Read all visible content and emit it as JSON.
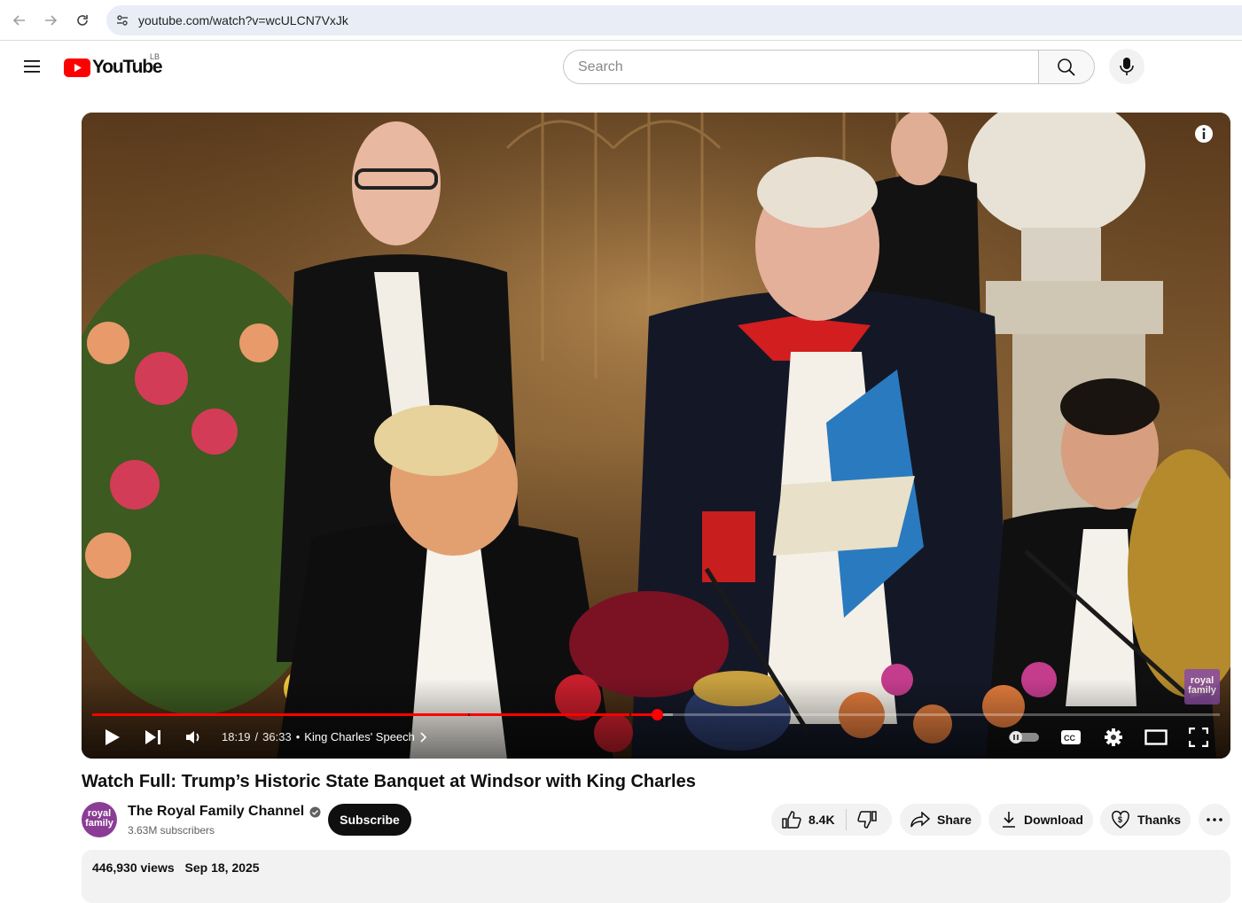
{
  "browser": {
    "url": "youtube.com/watch?v=wcULCN7VxJk"
  },
  "header": {
    "logo_text": "YouTube",
    "country_code": "LB",
    "search_placeholder": "Search"
  },
  "player": {
    "time_current": "18:19",
    "time_separator": "/",
    "time_total": "36:33",
    "chapter_bullet": "•",
    "chapter_title": "King Charles' Speech",
    "progress_fraction": 0.501,
    "buffered_fraction": 0.515,
    "watermark_text": "royal family",
    "autoplay": "paused"
  },
  "video": {
    "title": "Watch Full: Trump’s Historic State Banquet at Windsor with King Charles",
    "channel_name": "The Royal Family Channel",
    "subscribers": "3.63M subscribers",
    "avatar_text": "royal family",
    "subscribe_label": "Subscribe",
    "likes": "8.4K",
    "share_label": "Share",
    "download_label": "Download",
    "thanks_label": "Thanks",
    "views": "446,930 views",
    "date": "Sep 18, 2025"
  },
  "colors": {
    "accent": "#ff0000",
    "subscribe_bg": "#0f0f0f",
    "pill_bg": "#f2f2f2",
    "channel_avatar": "#8b3d96"
  }
}
